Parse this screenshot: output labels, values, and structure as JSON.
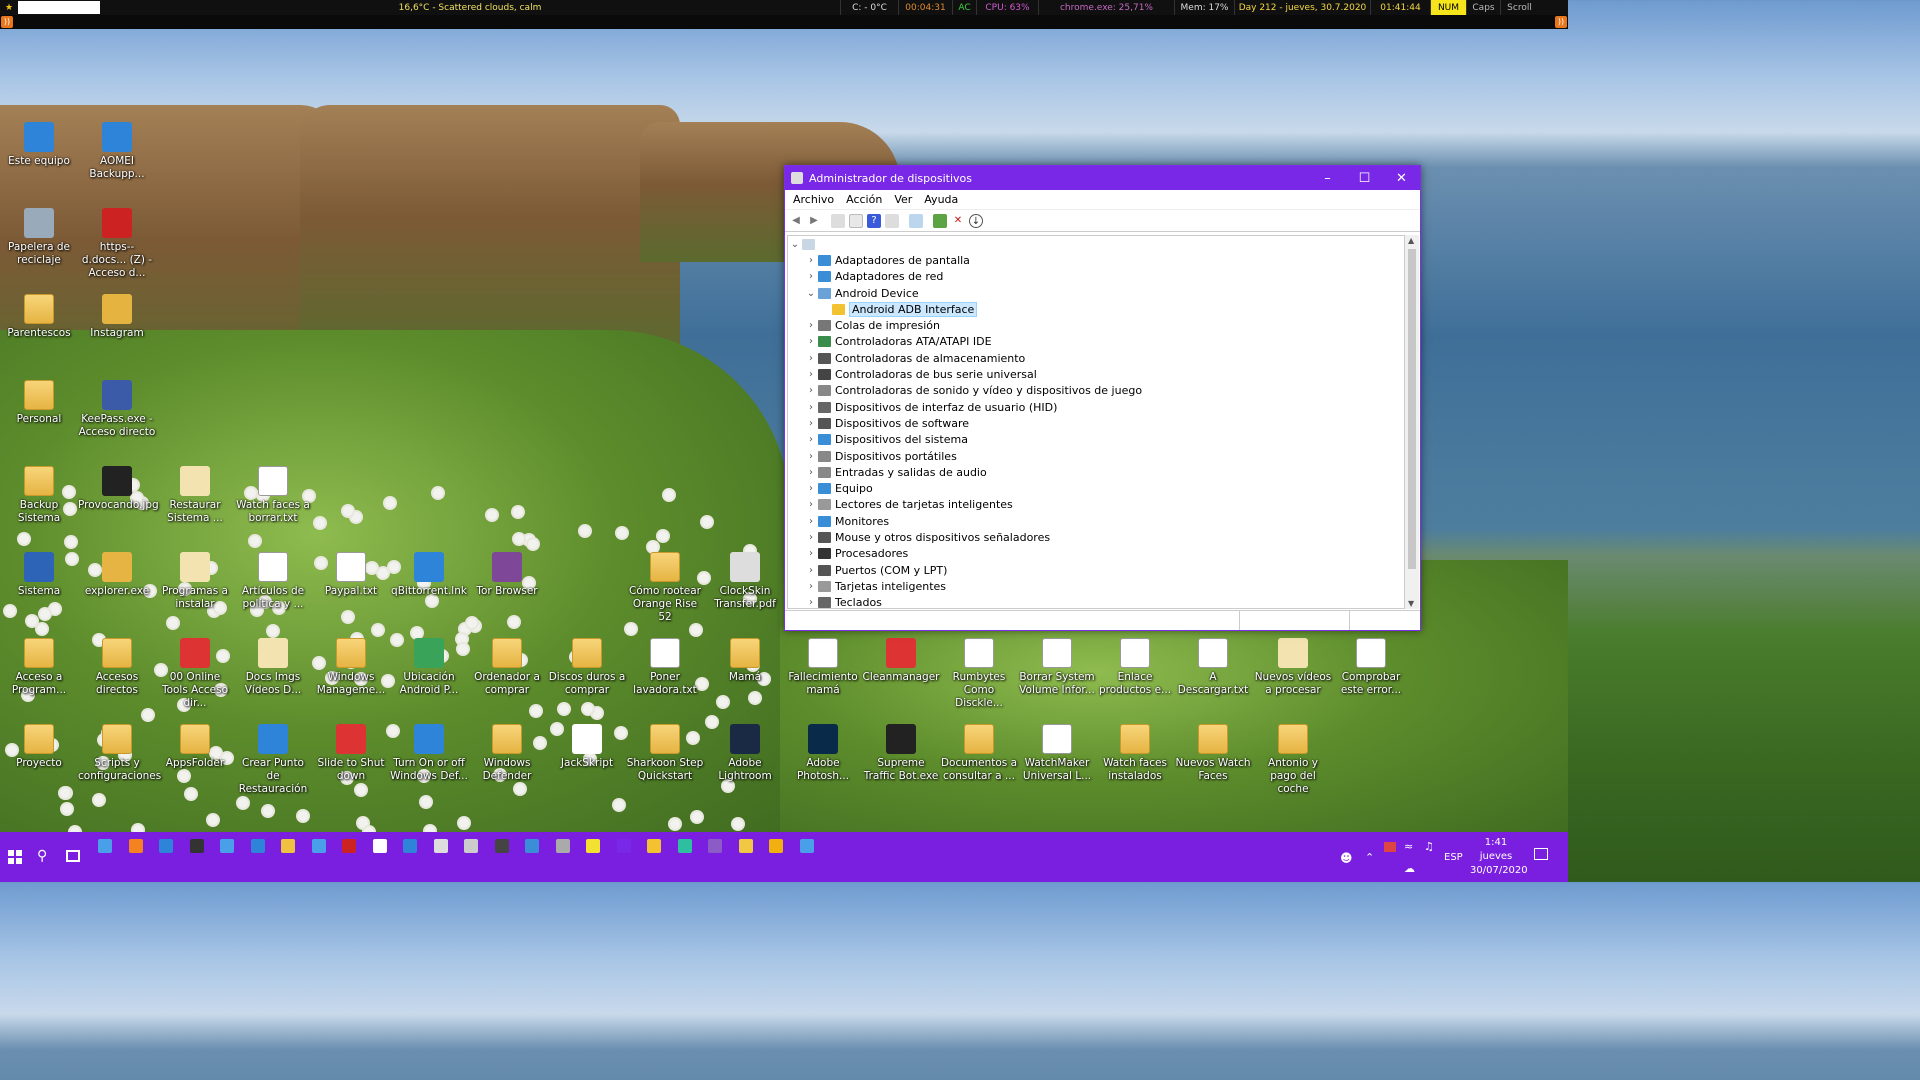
{
  "topbar": {
    "weather": "16,6°C - Scattered clouds, calm",
    "temp_c": "C: - 0°C",
    "uptime": "00:04:31",
    "ac": "AC",
    "cpu": "CPU: 63%",
    "process": "chrome.exe: 25,71%",
    "mem": "Mem: 17%",
    "day": "Day 212 - jueves, 30.7.2020",
    "clock": "01:41:44",
    "num": "NUM",
    "caps": "Caps",
    "scroll": "Scroll"
  },
  "desktop_icons": [
    {
      "label": "Este equipo",
      "icon": "computer-icon"
    },
    {
      "label": "AOMEI Backupp...",
      "icon": "backup-app-icon"
    },
    {
      "label": "Papelera de reciclaje",
      "icon": "recycle-bin-icon"
    },
    {
      "label": "https--d.docs... (Z) - Acceso d...",
      "icon": "network-drive-icon"
    },
    {
      "label": "Parentescos",
      "icon": "folder-icon"
    },
    {
      "label": "Instagram",
      "icon": "instagram-icon"
    },
    {
      "label": "Personal",
      "icon": "folder-icon"
    },
    {
      "label": "KeePass.exe - Acceso directo",
      "icon": "keepass-icon"
    },
    {
      "label": "Backup Sistema",
      "icon": "folder-icon"
    },
    {
      "label": "Provocando.jpg",
      "icon": "image-icon"
    },
    {
      "label": "Restaurar Sistema ...",
      "icon": "file-icon"
    },
    {
      "label": "Watch faces a borrar.txt",
      "icon": "text-file-icon"
    },
    {
      "label": "Sistema",
      "icon": "system-icon"
    },
    {
      "label": "explorer.exe",
      "icon": "explorer-icon"
    },
    {
      "label": "Programas a instalar",
      "icon": "file-icon"
    },
    {
      "label": "Artículos de política y ...",
      "icon": "text-file-icon"
    },
    {
      "label": "Paypal.txt",
      "icon": "text-file-icon"
    },
    {
      "label": "qBittorrent.lnk",
      "icon": "torrent-icon"
    },
    {
      "label": "Tor Browser",
      "icon": "tor-icon"
    },
    {
      "label": "Cómo rootear Orange Rise 52",
      "icon": "folder-icon"
    },
    {
      "label": "ClockSkin Transfer.pdf",
      "icon": "pdf-icon"
    },
    {
      "label": "Acceso a Program...",
      "icon": "folder-icon"
    },
    {
      "label": "Accesos directos",
      "icon": "folder-icon"
    },
    {
      "label": "00 Online Tools Acceso dir...",
      "icon": "chrome-icon"
    },
    {
      "label": "Docs Imgs Vídeos D...",
      "icon": "document-icon"
    },
    {
      "label": "Windows Manageme...",
      "icon": "folder-icon"
    },
    {
      "label": "Ubicación Android P...",
      "icon": "android-icon"
    },
    {
      "label": "Ordenador a comprar",
      "icon": "folder-icon"
    },
    {
      "label": "Discos duros a comprar",
      "icon": "folder-icon"
    },
    {
      "label": "Poner lavadora.txt",
      "icon": "text-file-icon"
    },
    {
      "label": "Mamá",
      "icon": "folder-icon"
    },
    {
      "label": "Fallecimiento mamá",
      "icon": "text-file-icon"
    },
    {
      "label": "Cleanmanager",
      "icon": "chrome-icon"
    },
    {
      "label": "Rumbytes Como Disckle...",
      "icon": "text-file-icon"
    },
    {
      "label": "Borrar System Volume Infor...",
      "icon": "text-file-icon"
    },
    {
      "label": "Enlace productos e...",
      "icon": "text-file-icon"
    },
    {
      "label": "A Descargar.txt",
      "icon": "text-file-icon"
    },
    {
      "label": "Nuevos vídeos a procesar",
      "icon": "document-icon"
    },
    {
      "label": "Comprobar este error...",
      "icon": "text-file-icon"
    },
    {
      "label": "Proyecto",
      "icon": "folder-icon"
    },
    {
      "label": "Scripts y configuraciones",
      "icon": "folder-icon"
    },
    {
      "label": "AppsFolder",
      "icon": "folder-icon"
    },
    {
      "label": "Crear Punto de Restauración",
      "icon": "restore-icon"
    },
    {
      "label": "Slide to Shut down",
      "icon": "power-icon"
    },
    {
      "label": "Turn On or off Windows Def...",
      "icon": "shield-icon"
    },
    {
      "label": "Windows Defender",
      "icon": "folder-icon"
    },
    {
      "label": "JackSkript",
      "icon": "java-icon"
    },
    {
      "label": "Sharkoon Step Quickstart",
      "icon": "folder-icon"
    },
    {
      "label": "Adobe Lightroom",
      "icon": "lightroom-icon"
    },
    {
      "label": "Adobe Photosh...",
      "icon": "photoshop-icon"
    },
    {
      "label": "Supreme Traffic Bot.exe",
      "icon": "bot-icon"
    },
    {
      "label": "Documentos a consultar a ...",
      "icon": "folder-icon"
    },
    {
      "label": "WatchMaker Universal L...",
      "icon": "text-file-icon"
    },
    {
      "label": "Watch faces instalados",
      "icon": "folder-icon"
    },
    {
      "label": "Nuevos Watch Faces",
      "icon": "folder-icon"
    },
    {
      "label": "Antonio y pago del coche",
      "icon": "folder-icon"
    }
  ],
  "window": {
    "title": "Administrador de dispositivos",
    "menu": [
      "Archivo",
      "Acción",
      "Ver",
      "Ayuda"
    ],
    "tree": [
      {
        "label": "Adaptadores de pantalla",
        "expanded": false,
        "icon": "display-adapter-icon"
      },
      {
        "label": "Adaptadores de red",
        "expanded": false,
        "icon": "network-adapter-icon"
      },
      {
        "label": "Android Device",
        "expanded": true,
        "icon": "android-device-icon"
      },
      {
        "label": "Android ADB Interface",
        "child": true,
        "selected": true,
        "icon": "warning-device-icon"
      },
      {
        "label": "Colas de impresión",
        "expanded": false,
        "icon": "printer-icon"
      },
      {
        "label": "Controladoras ATA/ATAPI IDE",
        "expanded": false,
        "icon": "ide-controller-icon"
      },
      {
        "label": "Controladoras de almacenamiento",
        "expanded": false,
        "icon": "storage-controller-icon"
      },
      {
        "label": "Controladoras de bus serie universal",
        "expanded": false,
        "icon": "usb-icon"
      },
      {
        "label": "Controladoras de sonido y vídeo y dispositivos de juego",
        "expanded": false,
        "icon": "sound-icon"
      },
      {
        "label": "Dispositivos de interfaz de usuario (HID)",
        "expanded": false,
        "icon": "hid-icon"
      },
      {
        "label": "Dispositivos de software",
        "expanded": false,
        "icon": "software-device-icon"
      },
      {
        "label": "Dispositivos del sistema",
        "expanded": false,
        "icon": "system-device-icon"
      },
      {
        "label": "Dispositivos portátiles",
        "expanded": false,
        "icon": "portable-device-icon"
      },
      {
        "label": "Entradas y salidas de audio",
        "expanded": false,
        "icon": "audio-io-icon"
      },
      {
        "label": "Equipo",
        "expanded": false,
        "icon": "computer-icon"
      },
      {
        "label": "Lectores de tarjetas inteligentes",
        "expanded": false,
        "icon": "smartcard-reader-icon"
      },
      {
        "label": "Monitores",
        "expanded": false,
        "icon": "monitor-icon"
      },
      {
        "label": "Mouse y otros dispositivos señaladores",
        "expanded": false,
        "icon": "mouse-icon"
      },
      {
        "label": "Procesadores",
        "expanded": false,
        "icon": "processor-icon"
      },
      {
        "label": "Puertos (COM y LPT)",
        "expanded": false,
        "icon": "port-icon"
      },
      {
        "label": "Tarjetas inteligentes",
        "expanded": false,
        "icon": "smartcard-icon"
      },
      {
        "label": "Teclados",
        "expanded": false,
        "icon": "keyboard-icon"
      }
    ]
  },
  "taskbar": {
    "lang": "ESP",
    "time": "1:41",
    "day": "jueves",
    "date": "30/07/2020"
  },
  "colors": {
    "accent": "#7a28e8",
    "taskbar": "#7a1fe0"
  }
}
